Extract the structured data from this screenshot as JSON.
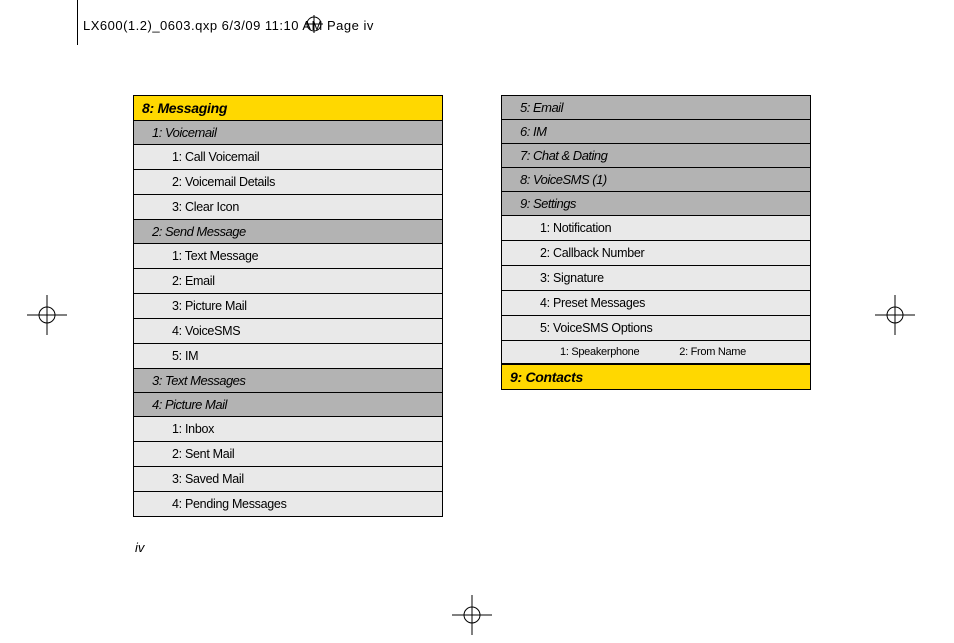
{
  "header_text": "LX600(1.2)_0603.qxp  6/3/09  11:10 AM  Page iv",
  "page_number": "iv",
  "col1": {
    "section": "8: Messaging",
    "groups": [
      {
        "header": "1: Voicemail",
        "items": [
          "1: Call Voicemail",
          "2: Voicemail Details",
          "3: Clear Icon"
        ]
      },
      {
        "header": "2: Send Message",
        "items": [
          "1: Text Message",
          "2: Email",
          "3: Picture Mail",
          "4: VoiceSMS",
          "5: IM"
        ]
      },
      {
        "header": "3: Text Messages",
        "items": []
      },
      {
        "header": "4: Picture Mail",
        "items": [
          "1: Inbox",
          "2: Sent Mail",
          "3: Saved Mail",
          "4: Pending Messages"
        ]
      }
    ]
  },
  "col2": {
    "top_subs": [
      "5: Email",
      "6: IM",
      "7: Chat & Dating",
      "8: VoiceSMS (1)",
      "9: Settings"
    ],
    "settings_items": [
      "1: Notification",
      "2: Callback Number",
      "3: Signature",
      "4: Preset Messages",
      "5: VoiceSMS Options"
    ],
    "sub_items": [
      "1: Speakerphone",
      "2: From Name"
    ],
    "section": "9: Contacts"
  }
}
